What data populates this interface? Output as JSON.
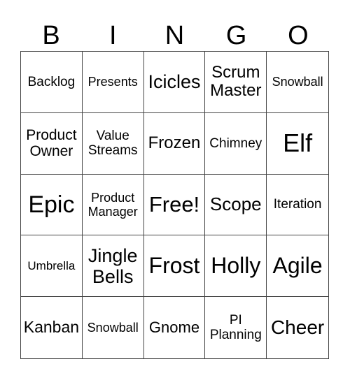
{
  "header": [
    "B",
    "I",
    "N",
    "G",
    "O"
  ],
  "cells": [
    {
      "text": "Backlog",
      "size": 19
    },
    {
      "text": "Presents",
      "size": 18
    },
    {
      "text": "Icicles",
      "size": 27
    },
    {
      "text": "Scrum\nMaster",
      "size": 24
    },
    {
      "text": "Snowball",
      "size": 18
    },
    {
      "text": "Product\nOwner",
      "size": 21
    },
    {
      "text": "Value\nStreams",
      "size": 19
    },
    {
      "text": "Frozen",
      "size": 24
    },
    {
      "text": "Chimney",
      "size": 19
    },
    {
      "text": "Elf",
      "size": 36
    },
    {
      "text": "Epic",
      "size": 34
    },
    {
      "text": "Product\nManager",
      "size": 18
    },
    {
      "text": "Free!",
      "size": 31
    },
    {
      "text": "Scope",
      "size": 26
    },
    {
      "text": "Iteration",
      "size": 19
    },
    {
      "text": "Umbrella",
      "size": 17
    },
    {
      "text": "Jingle\nBells",
      "size": 27
    },
    {
      "text": "Frost",
      "size": 32
    },
    {
      "text": "Holly",
      "size": 32
    },
    {
      "text": "Agile",
      "size": 32
    },
    {
      "text": "Kanban",
      "size": 23
    },
    {
      "text": "Snowball",
      "size": 18
    },
    {
      "text": "Gnome",
      "size": 22
    },
    {
      "text": "PI\nPlanning",
      "size": 19
    },
    {
      "text": "Cheer",
      "size": 28
    }
  ]
}
